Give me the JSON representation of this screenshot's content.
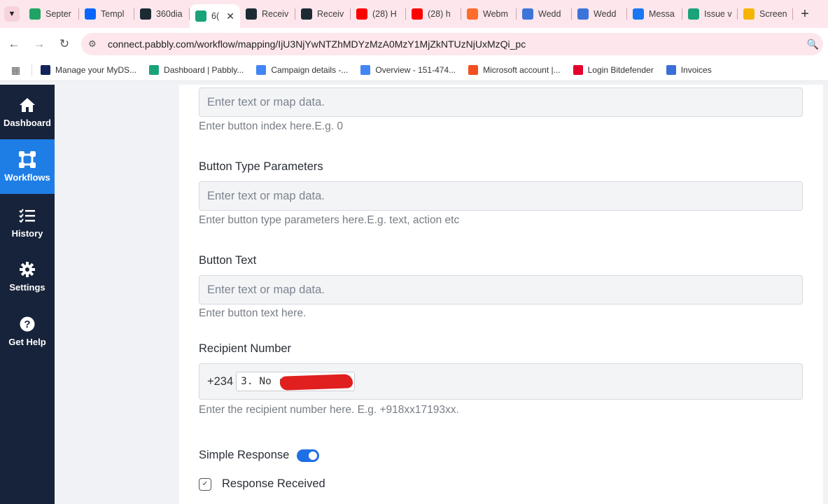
{
  "browser": {
    "tabs": [
      {
        "title": "Septer",
        "icon": "google-sheets-icon",
        "color": "#1fa463"
      },
      {
        "title": "Templ",
        "icon": "meta-icon",
        "color": "#0866ff"
      },
      {
        "title": "360dia",
        "icon": "360dialog-icon",
        "color": "#1c2b33"
      },
      {
        "title": "6(",
        "icon": "pabbly-icon",
        "color": "#1aa37a",
        "active": true
      },
      {
        "title": "Receiv",
        "icon": "360dialog-icon",
        "color": "#1c2b33"
      },
      {
        "title": "Receiv",
        "icon": "360dialog-icon",
        "color": "#1c2b33"
      },
      {
        "title": "(28) H",
        "icon": "youtube-icon",
        "color": "#ff0000"
      },
      {
        "title": "(28) h",
        "icon": "youtube-icon",
        "color": "#ff0000"
      },
      {
        "title": "Webm",
        "icon": "cpanel-icon",
        "color": "#ff6c2c"
      },
      {
        "title": "Wedd",
        "icon": "pabbly-p-icon",
        "color": "#3d74d9"
      },
      {
        "title": "Wedd",
        "icon": "pabbly-p-icon",
        "color": "#3d74d9"
      },
      {
        "title": "Messa",
        "icon": "facebook-icon",
        "color": "#1877f2"
      },
      {
        "title": "Issue v",
        "icon": "pabbly-icon",
        "color": "#1aa37a"
      },
      {
        "title": "Screen",
        "icon": "google-drive-icon",
        "color": "#f4b400"
      }
    ],
    "url": "connect.pabbly.com/workflow/mapping/IjU3NjYwNTZhMDYzMzA0MzY1MjZkNTUzNjUxMzQi_pc",
    "bookmarks": [
      {
        "label": "Manage your MyDS...",
        "color": "#14235b"
      },
      {
        "label": "Dashboard | Pabbly...",
        "color": "#1aa37a"
      },
      {
        "label": "Campaign details -...",
        "color": "#4285f4"
      },
      {
        "label": "Overview - 151-474...",
        "color": "#4285f4"
      },
      {
        "label": "Microsoft account |...",
        "color": "#f25022"
      },
      {
        "label": "Login Bitdefender",
        "color": "#e4002b"
      },
      {
        "label": "Invoices",
        "color": "#3a6fd8"
      }
    ]
  },
  "sidebar": {
    "items": [
      {
        "label": "Dashboard",
        "icon": "home-icon"
      },
      {
        "label": "Workflows",
        "icon": "workflow-icon",
        "active": true
      },
      {
        "label": "History",
        "icon": "list-check-icon"
      },
      {
        "label": "Settings",
        "icon": "gear-icon"
      },
      {
        "label": "Get Help",
        "icon": "help-icon"
      }
    ]
  },
  "form": {
    "button_index": {
      "placeholder": "Enter text or map data.",
      "help": "Enter button index here.E.g. 0"
    },
    "button_type_parameters": {
      "label": "Button Type Parameters",
      "placeholder": "Enter text or map data.",
      "help": "Enter button type parameters here.E.g. text, action etc"
    },
    "button_text": {
      "label": "Button Text",
      "placeholder": "Enter text or map data.",
      "help": "Enter button text here."
    },
    "recipient_number": {
      "label": "Recipient Number",
      "prefix": "+234",
      "mapped_value": "3. No : 7",
      "help": "Enter the recipient number here. E.g. +918xx17193xx."
    },
    "simple_response": {
      "label": "Simple Response",
      "enabled": true
    },
    "response_received": {
      "label": "Response Received"
    }
  }
}
